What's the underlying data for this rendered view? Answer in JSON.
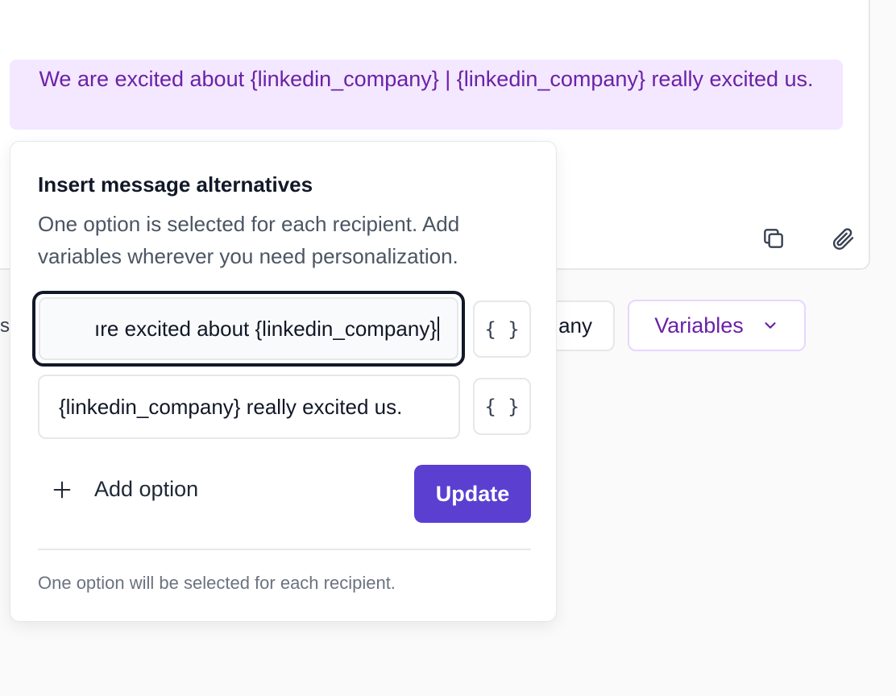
{
  "editor": {
    "highlighted_text": "We are excited about {linkedin_company} | {linkedin_company} really excited us.",
    "icons": [
      "copy-icon",
      "paperclip-icon"
    ]
  },
  "chips": {
    "edge_text": "s",
    "company_chip": "any",
    "variables_label": "Variables"
  },
  "popover": {
    "title": "Insert message alternatives",
    "description": "One option is selected for each recipient. Add variables wherever you need personalization.",
    "options": [
      {
        "value": "ıre excited about {linkedin_company}"
      },
      {
        "value": "{linkedin_company} really excited us."
      }
    ],
    "variable_button_label": "{ }",
    "add_option_label": "Add option",
    "update_label": "Update",
    "footnote": "One option will be selected for each recipient."
  },
  "colors": {
    "accent": "#5b3fd1",
    "highlight_bg": "#f3e8ff",
    "highlight_text": "#6b21a8"
  }
}
